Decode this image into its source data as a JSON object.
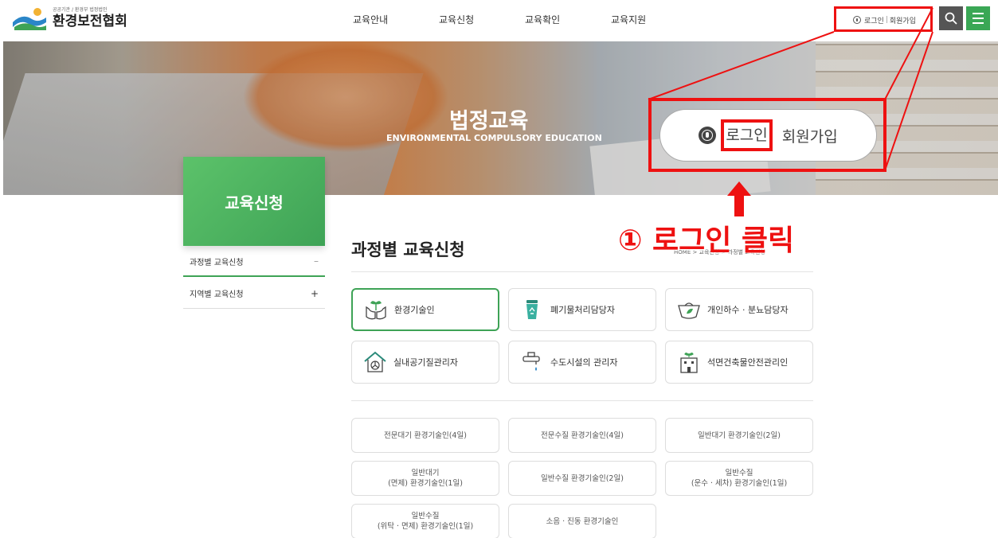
{
  "header": {
    "logo_sub": "공공기관 / 환경부 법정법인",
    "logo_name": "환경보전협회",
    "gnb": [
      "교육안내",
      "교육신청",
      "교육확인",
      "교육지원"
    ],
    "login_label": "로그인",
    "join_label": "회원가입",
    "util_sep": "|"
  },
  "banner": {
    "title": "법정교육",
    "subtitle": "ENVIRONMENTAL COMPULSORY EDUCATION"
  },
  "callout": {
    "login_label": "로그인",
    "join_label": "회원가입",
    "step": "① 로그인 클릭",
    "accent_color": "#ee1111"
  },
  "sidebar": {
    "title": "교육신청",
    "items": [
      {
        "label": "과정별 교육신청",
        "mark": "–"
      },
      {
        "label": "지역별 교육신청",
        "mark": "+"
      }
    ]
  },
  "content": {
    "title": "과정별 교육신청",
    "breadcrumb": "HOME  >  교육신청  >  과정별 교육신청",
    "categories": [
      {
        "label": "환경기술인",
        "icon": "hands-plant-icon"
      },
      {
        "label": "폐기물처리담당자",
        "icon": "recycle-bin-icon"
      },
      {
        "label": "개인하수 · 분뇨담당자",
        "icon": "tank-leaf-icon"
      },
      {
        "label": "실내공기질관리자",
        "icon": "house-fan-icon"
      },
      {
        "label": "수도시설의 관리자",
        "icon": "faucet-icon"
      },
      {
        "label": "석면건축물안전관리인",
        "icon": "building-plant-icon"
      }
    ],
    "courses": [
      "전문대기 환경기술인(4일)",
      "전문수질 환경기술인(4일)",
      "일반대기 환경기술인(2일)",
      "일반대기\n(면제) 환경기술인(1일)",
      "일반수질 환경기술인(2일)",
      "일반수질\n(운수 · 세차) 환경기술인(1일)",
      "일반수질\n(위탁 · 면제) 환경기술인(1일)",
      "소음 · 진동 환경기술인"
    ]
  },
  "colors": {
    "brand_green": "#3ea356",
    "highlight_red": "#ee1111"
  }
}
